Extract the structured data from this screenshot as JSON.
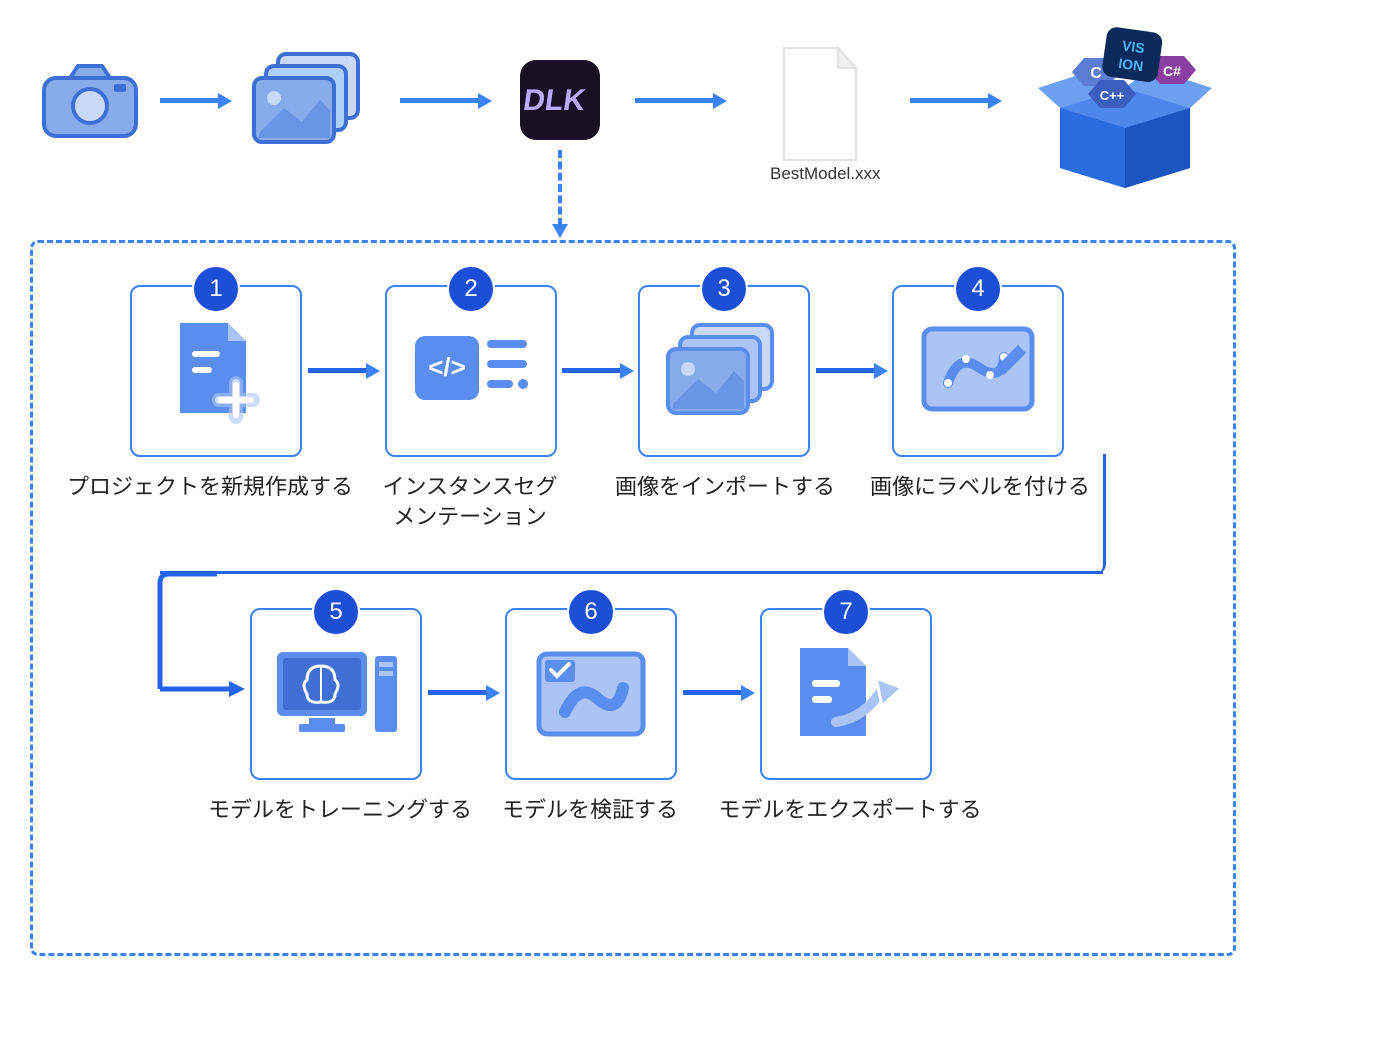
{
  "top_flow": {
    "file_label": "BestModel.xxx"
  },
  "steps": [
    {
      "num": "1",
      "label": "プロジェクトを新規作成する"
    },
    {
      "num": "2",
      "label": "インスタンスセグ\nメンテーション"
    },
    {
      "num": "3",
      "label": "画像をインポートする"
    },
    {
      "num": "4",
      "label": "画像にラベルを付ける"
    },
    {
      "num": "5",
      "label": "モデルをトレーニングする"
    },
    {
      "num": "6",
      "label": "モデルを検証する"
    },
    {
      "num": "7",
      "label": "モデルをエクスポートする"
    }
  ],
  "colors": {
    "primary": "#3b82f6",
    "primary_dark": "#2563eb",
    "badge": "#1d4ed8",
    "icon_fill": "#5b8def",
    "icon_light": "#a9c4f5"
  }
}
